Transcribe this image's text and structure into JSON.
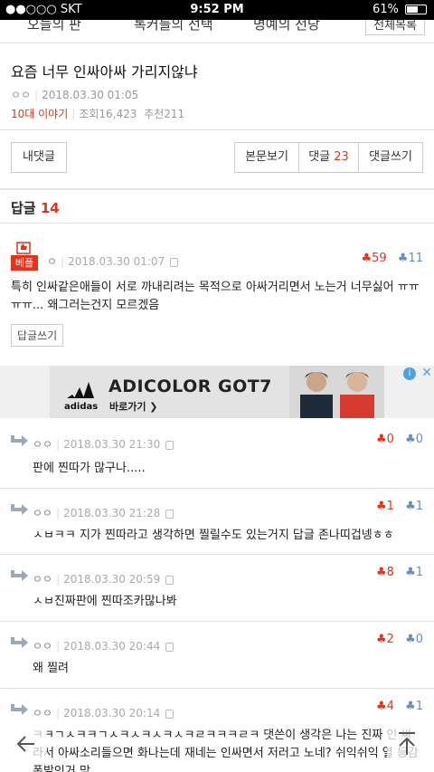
{
  "status": {
    "carrier": "●●○○○ SKT",
    "time": "9:52 PM",
    "battery": "61%",
    "battery_level": 0.61
  },
  "topnav": {
    "items": [
      "오늘의 판",
      "톡커들의 선택",
      "명예의 전당"
    ],
    "all_label": "전체목록"
  },
  "post": {
    "title": "요즘 너무 인싸아싸 가리지않냐",
    "author": "ㅇㅇ",
    "datetime": "2018.03.30 01:05",
    "category": "10대 이야기",
    "views": "조회16,423",
    "recommends": "추천211"
  },
  "buttons": {
    "my_comments": "내댓글",
    "view_body": "본문보기",
    "comments_label": "댓글",
    "comments_count": "23",
    "write_comment": "댓글쓰기"
  },
  "replies": {
    "label": "답글",
    "count": "14"
  },
  "best_comment": {
    "badge": "베플",
    "author": "ㅇ",
    "datetime": "2018.03.30 01:07",
    "up": "59",
    "down": "11",
    "body": "특히 인싸같은애들이 서로 까내리려는 목적으로 아싸거리면서 노는거 너무싫어 ㅠㅠㅠㅠ... 왜그러는건지 모르겠음",
    "reply_button": "답글쓰기"
  },
  "ad": {
    "brand": "adidas",
    "title": "ADICOLOR GOT7",
    "go": "바로가기 ❯",
    "info": "i",
    "close": "✕"
  },
  "comments": [
    {
      "author": "ㅇㅇ",
      "datetime": "2018.03.30 21:30",
      "up": "0",
      "down": "0",
      "body": "판에 찐따가 많구나....."
    },
    {
      "author": "ㅇㅇ",
      "datetime": "2018.03.30 21:28",
      "up": "1",
      "down": "1",
      "body": "ㅅㅂㅋㅋ 지가 찐따라고 생각하면 찔릴수도 있는거지 답글 존나띠겁넹ㅎㅎ"
    },
    {
      "author": "ㅇㅇ",
      "datetime": "2018.03.30 20:59",
      "up": "8",
      "down": "1",
      "body": "ㅅㅂ진짜판에 찐따조카많나봐"
    },
    {
      "author": "ㅇㅇ",
      "datetime": "2018.03.30 20:44",
      "up": "2",
      "down": "0",
      "body": "왜 찔려"
    },
    {
      "author": "ㅇㅇ",
      "datetime": "2018.03.30 20:14",
      "up": "4",
      "down": "1",
      "body": "ㅋㅋㄱㅅㅋㅋㄱㅅㅋㅅㅋㅅㅋㅅㅋㄹㅋㅋㅋㄹㅋ 댓쓴이 생각은 나는 진짜 인 싸라서 아싸소리들으면 화나는데 재네는 인싸면서 저러고 노네? 쉬익쉬익 열 등감폭발인거 맘"
    }
  ],
  "colors": {
    "accent_red": "#e8311a",
    "down_blue": "#6a8fb5"
  }
}
